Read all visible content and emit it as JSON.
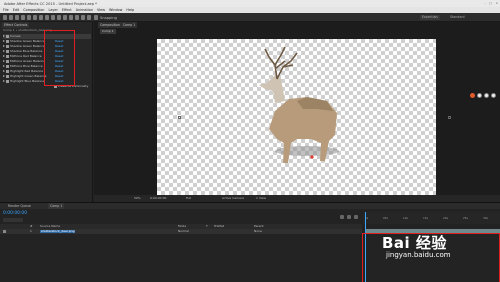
{
  "window": {
    "title": "Adobe After Effects CC 2015 - Untitled Project.aep *"
  },
  "menu": [
    "File",
    "Edit",
    "Composition",
    "Layer",
    "Effect",
    "Animation",
    "View",
    "Window",
    "Help"
  ],
  "toolbar": {
    "snapping_label": "Snapping",
    "workspaces": [
      "Essentials",
      "Standard"
    ]
  },
  "effect_panel": {
    "tab_label": "Effect Controls",
    "layer_label": "Comp 1 • shutterstock_deer.png",
    "effects": [
      {
        "name": "Curves",
        "reset": ""
      },
      {
        "name": "Shadow Green Balance",
        "reset": "Reset"
      },
      {
        "name": "Shadow Green Balance",
        "reset": "Reset"
      },
      {
        "name": "Shadow Blue Balance",
        "reset": "Reset"
      },
      {
        "name": "Midtone Red Balance",
        "reset": "Reset"
      },
      {
        "name": "Midtone Green Balance",
        "reset": "Reset"
      },
      {
        "name": "Midtone Blue Balance",
        "reset": "Reset"
      },
      {
        "name": "Highlight Red Balance",
        "reset": "Reset"
      },
      {
        "name": "Highlight Green Balance",
        "reset": "Reset"
      },
      {
        "name": "Highlight Blue Balance",
        "reset": "Reset"
      }
    ],
    "preserve_label": "Preserve Luminosity"
  },
  "comp_panel": {
    "tab_label": "Composition",
    "comp_name": "Comp 1",
    "subtab": "Comp 1",
    "footer": {
      "zoom": "50%",
      "time": "0:00:00:00",
      "quality": "Full",
      "camera": "Active Camera",
      "views": "1 View"
    }
  },
  "timeline": {
    "tabs": [
      "Render Queue",
      "Comp 1"
    ],
    "timecode": "0:00:00:00",
    "column_headers": [
      "#",
      "Source Name",
      "Mode",
      "T",
      "TrkMat",
      "Parent"
    ],
    "layer": {
      "index": "1",
      "name": "shutterstock_deer.png",
      "mode": "Normal",
      "parent": "None"
    },
    "ruler_ticks": [
      "0s",
      "05s",
      "10s",
      "15s",
      "20s",
      "25s",
      "30s"
    ]
  },
  "watermark": {
    "brand": "Bai 经验",
    "url": "jingyan.baidu.com"
  },
  "colors": {
    "accent": "#3ba7ff",
    "highlight_box": "#e02020"
  }
}
